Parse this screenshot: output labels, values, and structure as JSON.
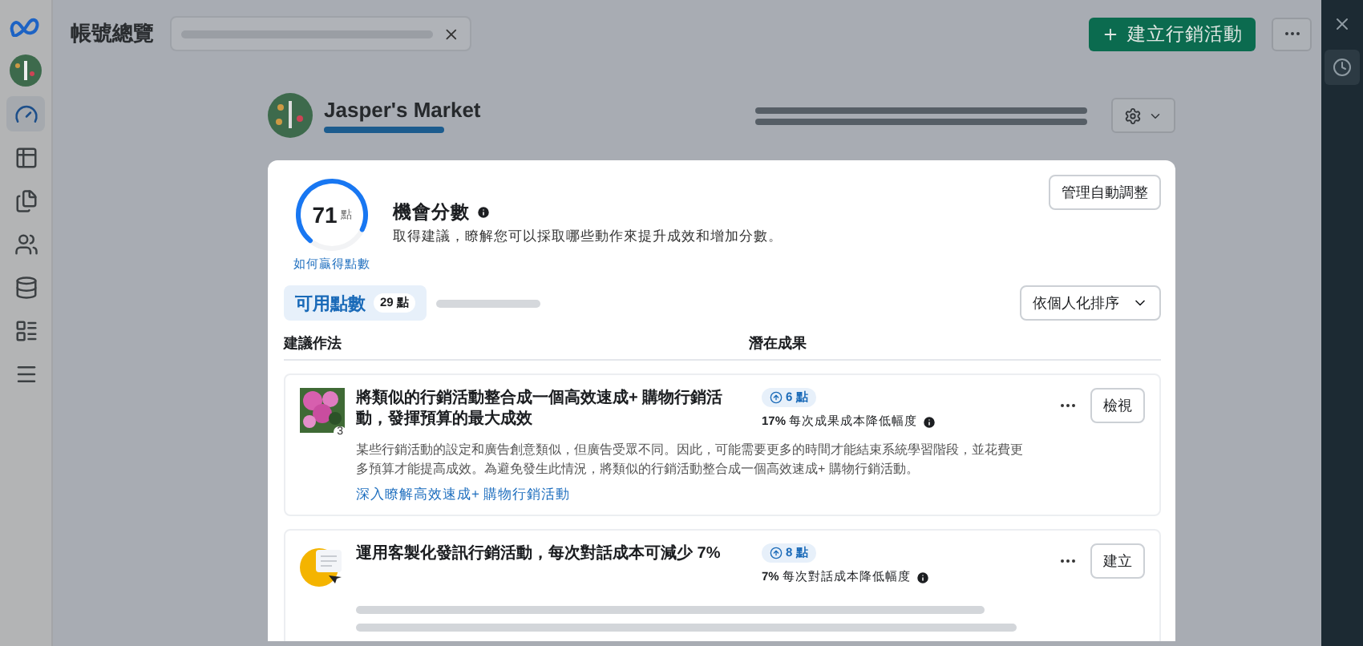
{
  "sidebar": {
    "items": [
      {
        "kind": "logo",
        "selected": false
      },
      {
        "kind": "avatar",
        "selected": false
      },
      {
        "kind": "dashboard",
        "selected": true
      },
      {
        "kind": "table",
        "selected": false
      },
      {
        "kind": "pages",
        "selected": false
      },
      {
        "kind": "people",
        "selected": false
      },
      {
        "kind": "billing",
        "selected": false
      },
      {
        "kind": "card",
        "selected": false
      },
      {
        "kind": "menu",
        "selected": false
      }
    ]
  },
  "topbar": {
    "title": "帳號總覽",
    "create_button": "建立行銷活動"
  },
  "account": {
    "name": "Jasper's Market"
  },
  "score": {
    "value": "71",
    "unit": "點",
    "level": 0.71,
    "link": "如何贏得點數",
    "title": "機會分數",
    "subtitle": "取得建議，瞭解您可以採取哪些動作來提升成效和增加分數。",
    "manage_button": "管理自動調整"
  },
  "points_tab": {
    "label": "可用點數",
    "badge": "29 點",
    "selected": true
  },
  "sort_dropdown": "依個人化排序",
  "columns": [
    "建議作法",
    "潛在成果"
  ],
  "recommendations": [
    {
      "title": "將類似的行銷活動整合成一個高效速成+ 購物行銷活動，發揮預算的最大成效",
      "count": "3",
      "points": "6 點",
      "metric": "17%",
      "metric_label": "每次成果成本降低幅度",
      "action": "檢視",
      "description": "某些行銷活動的設定和廣告創意類似，但廣告受眾不同。因此，可能需要更多的時間才能結束系統學習階段，並花費更多預算才能提高成效。為避免發生此情況，將類似的行銷活動整合成一個高效速成+ 購物行銷活動。",
      "link": "深入瞭解高效速成+ 購物行銷活動"
    },
    {
      "kind": "illustration",
      "title": "運用客製化發訊行銷活動，每次對話成本可減少 7%",
      "points": "8 點",
      "metric": "7%",
      "metric_label": "每次對話成本降低幅度",
      "action": "建立"
    }
  ]
}
